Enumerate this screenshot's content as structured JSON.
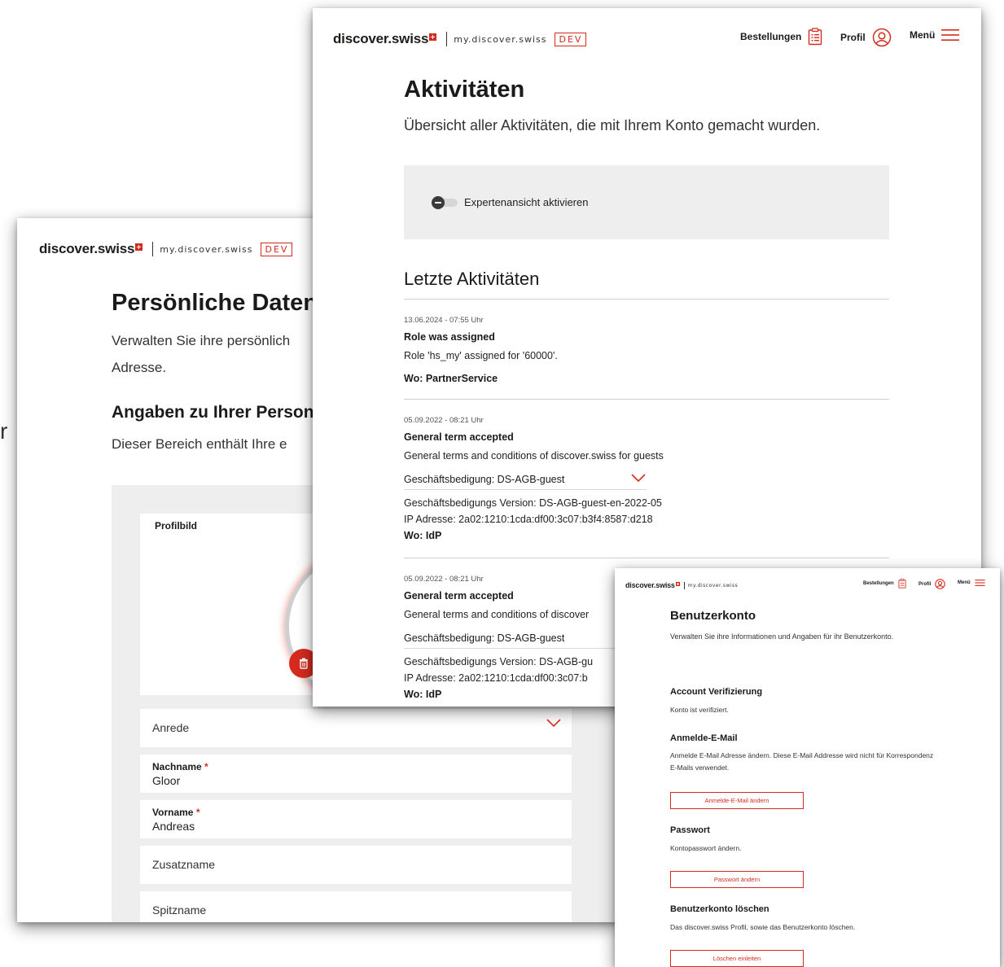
{
  "stray_glyph": "r",
  "brand": {
    "name": "discover.swiss",
    "subtitle": "my.discover.swiss",
    "env": "DEV"
  },
  "nav": {
    "orders": "Bestellungen",
    "profile": "Profil",
    "menu": "Menü"
  },
  "personal": {
    "title": "Persönliche Daten",
    "description": "Verwalten Sie ihre persönlichen Daten. Adresse.",
    "desc_line1": "Verwalten Sie ihre persönlich",
    "desc_line2": "Adresse.",
    "section_title": "Angaben zu Ihrer Person",
    "section_desc": "Dieser Bereich enthält Ihre e",
    "profile_picture_label": "Profilbild",
    "fields": {
      "salutation_placeholder": "Anrede",
      "lastname_label": "Nachname",
      "lastname_value": "Gloor",
      "firstname_label": "Vorname",
      "firstname_value": "Andreas",
      "additional_name_placeholder": "Zusatzname",
      "nickname_placeholder": "Spitzname",
      "required_marker": "*"
    }
  },
  "activities": {
    "title": "Aktivitäten",
    "description": "Übersicht aller Aktivitäten, die mit Ihrem Konto gemacht wurden.",
    "expert_toggle_label": "Expertenansicht aktivieren",
    "expert_toggle_on": false,
    "recent_title": "Letzte Aktivitäten",
    "items": [
      {
        "date": "13.06.2024 - 07:55 Uhr",
        "title": "Role was assigned",
        "text": "Role 'hs_my' assigned for '60000'.",
        "where": "Wo: PartnerService"
      },
      {
        "date": "05.09.2022 - 08:21 Uhr",
        "title": "General term accepted",
        "text": "General terms and conditions of discover.swiss for guests",
        "terms_select": "Geschäftsbedigung:  DS-AGB-guest",
        "version": "Geschäftsbedigungs Version:  DS-AGB-guest-en-2022-05",
        "ip": "IP Adresse:  2a02:1210:1cda:df00:3c07:b3f4:8587:d218",
        "where": "Wo: IdP"
      },
      {
        "date": "05.09.2022 - 08:21 Uhr",
        "title": "General term accepted",
        "text": "General terms and conditions of discover",
        "terms_select": "Geschäftsbedigung:  DS-AGB-guest",
        "version": "Geschäftsbedigungs Version:  DS-AGB-gu",
        "ip": "IP Adresse:  2a02:1210:1cda:df00:3c07:b",
        "where": "Wo: IdP"
      }
    ]
  },
  "account": {
    "title": "Benutzerkonto",
    "description": "Verwalten Sie ihre Informationen und Angaben für ihr Benutzerkonto.",
    "verification_title": "Account Verifizierung",
    "verification_text": "Konto ist verifiziert.",
    "email_title": "Anmelde-E-Mail",
    "email_text": "Anmelde E-Mail Adresse ändern. Diese E-Mail Addresse wird nicht für Korrespondenz E-Mails verwendet.",
    "email_button": "Anmelde-E-Mail ändern",
    "password_title": "Passwort",
    "password_text": "Kontopasswort ändern.",
    "password_button": "Passwort ändern",
    "delete_title": "Benutzerkonto löschen",
    "delete_text": "Das discover.swiss Profil, sowie das Benutzerkonto löschen.",
    "delete_button": "Löschen einleiten"
  },
  "colors": {
    "accent": "#d52b1e",
    "panel": "#eeeeee",
    "text": "#1a1a1a"
  }
}
